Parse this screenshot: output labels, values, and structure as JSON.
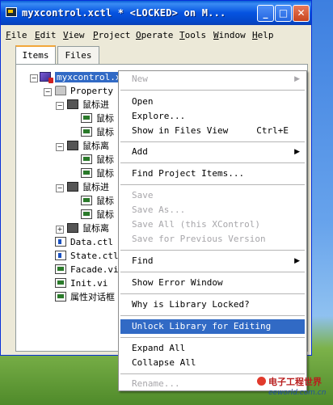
{
  "window": {
    "title": "myxcontrol.xctl * <LOCKED> on M...",
    "buttons": {
      "minimize": "_",
      "maximize": "□",
      "close": "✕"
    }
  },
  "menubar": [
    "File",
    "Edit",
    "View",
    "Project",
    "Operate",
    "Tools",
    "Window",
    "Help"
  ],
  "tabs": [
    {
      "label": "Items",
      "active": true
    },
    {
      "label": "Files",
      "active": false
    }
  ],
  "tree": {
    "root": "myxcontrol.x",
    "nodes": [
      {
        "label": "Property",
        "icon": "folder-icon"
      },
      {
        "label": "鼠标进",
        "icon": "group-icon"
      },
      {
        "label": "鼠标",
        "icon": "vi-icon"
      },
      {
        "label": "鼠标",
        "icon": "vi-icon"
      },
      {
        "label": "鼠标离",
        "icon": "group-icon"
      },
      {
        "label": "鼠标",
        "icon": "vi-icon"
      },
      {
        "label": "鼠标",
        "icon": "vi-icon"
      },
      {
        "label": "鼠标进",
        "icon": "group-icon"
      },
      {
        "label": "鼠标",
        "icon": "vi-icon"
      },
      {
        "label": "鼠标",
        "icon": "vi-icon"
      },
      {
        "label": "鼠标离",
        "icon": "group-icon"
      },
      {
        "label": "Data.ctl",
        "icon": "ctl-icon"
      },
      {
        "label": "State.ctl",
        "icon": "ctl-icon"
      },
      {
        "label": "Facade.vi",
        "icon": "vi-icon"
      },
      {
        "label": "Init.vi",
        "icon": "vi-icon"
      },
      {
        "label": "属性对话框",
        "icon": "vi-icon"
      }
    ]
  },
  "context_menu": {
    "items": [
      {
        "label": "New",
        "disabled": true,
        "submenu": true
      },
      {
        "sep": true
      },
      {
        "label": "Open"
      },
      {
        "label": "Explore..."
      },
      {
        "label": "Show in Files View",
        "shortcut": "Ctrl+E"
      },
      {
        "sep": true
      },
      {
        "label": "Add",
        "submenu": true
      },
      {
        "sep": true
      },
      {
        "label": "Find Project Items..."
      },
      {
        "sep": true
      },
      {
        "label": "Save",
        "disabled": true
      },
      {
        "label": "Save As...",
        "disabled": true
      },
      {
        "label": "Save All (this XControl)",
        "disabled": true
      },
      {
        "label": "Save for Previous Version",
        "disabled": true
      },
      {
        "sep": true
      },
      {
        "label": "Find",
        "submenu": true
      },
      {
        "sep": true
      },
      {
        "label": "Show Error Window"
      },
      {
        "sep": true
      },
      {
        "label": "Why is Library Locked?"
      },
      {
        "sep": true
      },
      {
        "label": "Unlock Library for Editing",
        "highlighted": true
      },
      {
        "sep": true
      },
      {
        "label": "Expand All"
      },
      {
        "label": "Collapse All"
      },
      {
        "sep": true
      },
      {
        "label": "Rename...",
        "disabled": true
      }
    ]
  },
  "watermark": {
    "line1": "电子工程世界",
    "line2": "eeworld.com.cn"
  },
  "colors": {
    "title_bar": "#0553e0",
    "selection": "#316ac5",
    "window_bg": "#ece9d8"
  }
}
